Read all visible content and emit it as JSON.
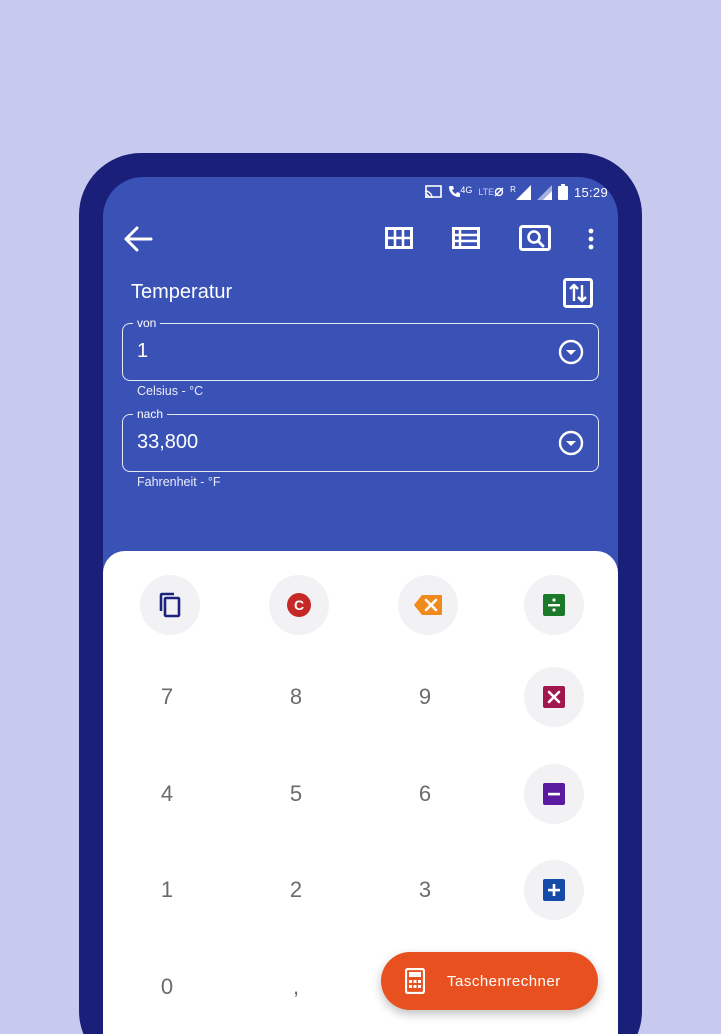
{
  "status_bar": {
    "network_label": "4G",
    "lte_label": "LTE",
    "roaming_label": "R",
    "time": "15:29",
    "icons": [
      "cast-icon",
      "wifi-call-icon",
      "lte-icon",
      "signal-icon",
      "signal-icon",
      "battery-icon"
    ]
  },
  "app_bar": {
    "icons": [
      "arrow-back-icon",
      "grid-icon",
      "list-icon",
      "search-icon",
      "more-vert-icon"
    ]
  },
  "converter": {
    "title": "Temperatur",
    "from": {
      "legend": "von",
      "value": "1",
      "unit": "Celsius - °C"
    },
    "to": {
      "legend": "nach",
      "value": "33,800",
      "unit": "Fahrenheit - °F"
    }
  },
  "keypad": {
    "function_keys": [
      {
        "icon": "copy-icon",
        "color": "#1a237e"
      },
      {
        "label": "C",
        "icon": "clear-icon",
        "color": "#c62828"
      },
      {
        "icon": "backspace-icon",
        "color": "#f08a1c"
      },
      {
        "icon": "divide-icon",
        "color": "#1b7a2a"
      }
    ],
    "rows": [
      [
        "7",
        "8",
        "9"
      ],
      [
        "4",
        "5",
        "6"
      ],
      [
        "1",
        "2",
        "3"
      ],
      [
        "0",
        ","
      ]
    ],
    "operators": [
      {
        "icon": "multiply-icon",
        "color": "#a0184d"
      },
      {
        "icon": "minus-icon",
        "color": "#5b1ba0"
      },
      {
        "icon": "plus-icon",
        "color": "#154aa8"
      }
    ]
  },
  "fab": {
    "label": "Taschenrechner",
    "icon": "calculator-icon",
    "color": "#e8501f"
  }
}
